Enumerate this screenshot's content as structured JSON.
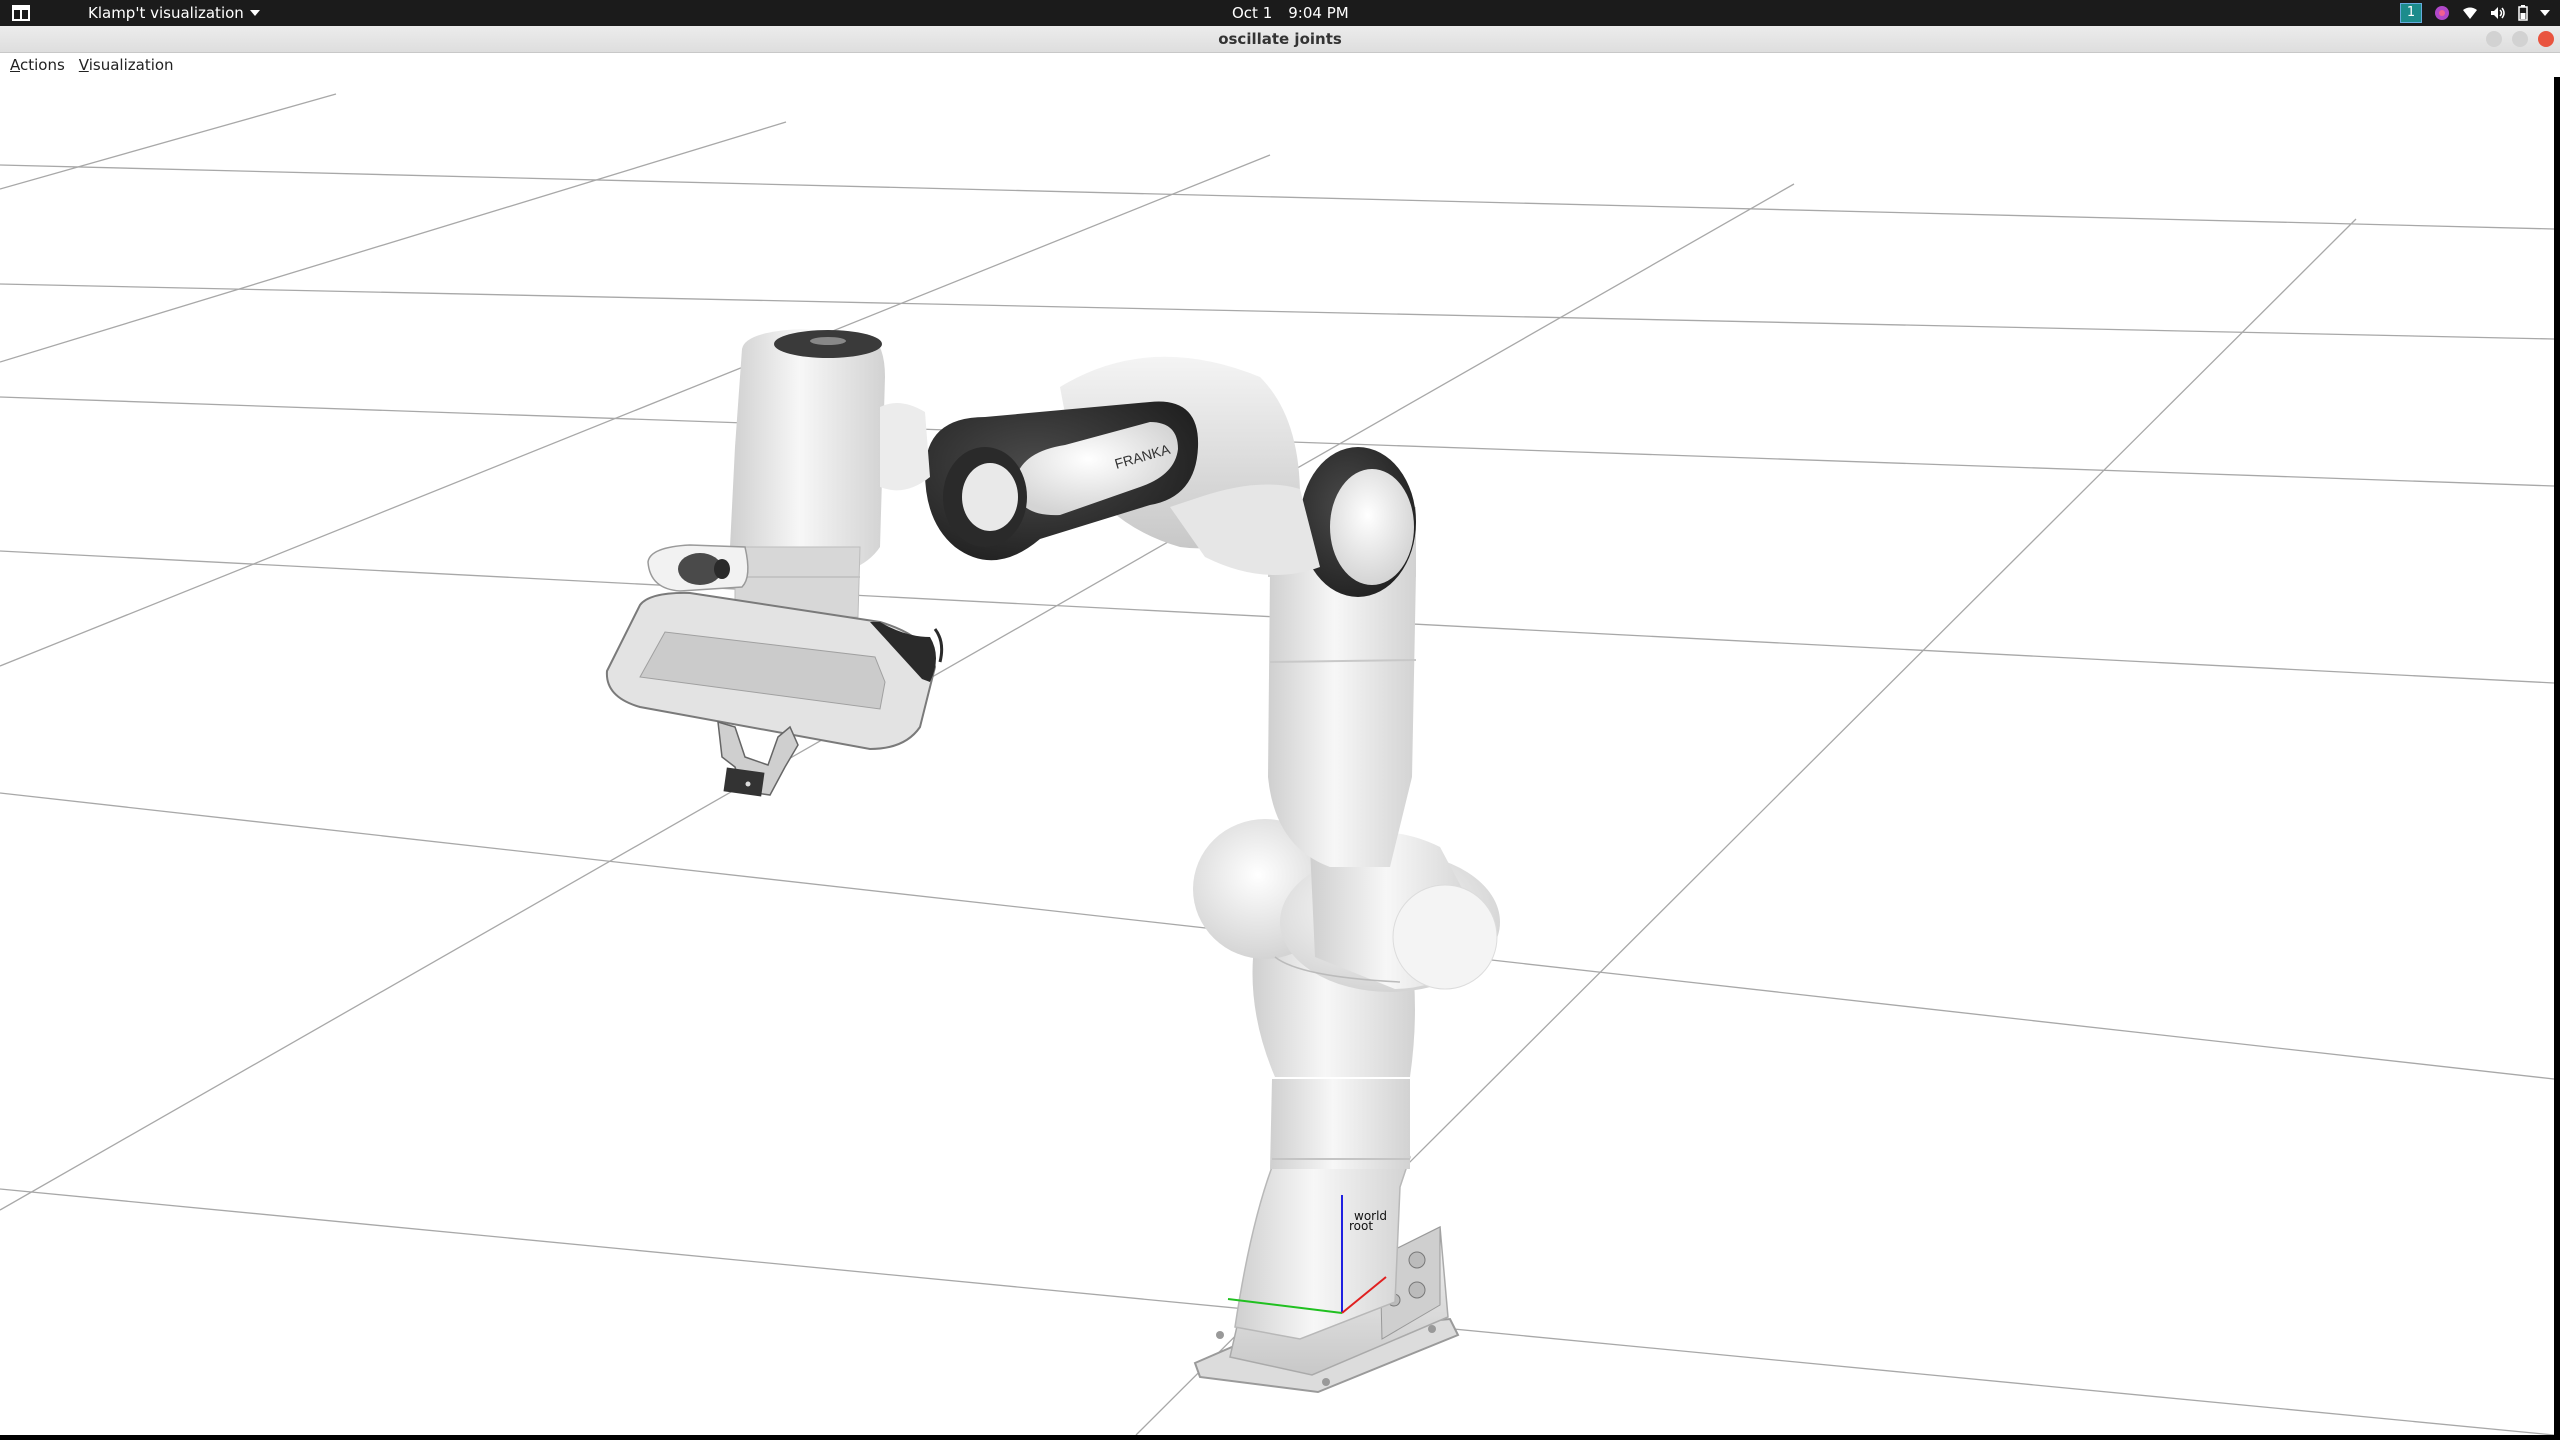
{
  "topbar": {
    "app_menu": "Klamp't visualization",
    "date": "Oct 1",
    "time": "9:04 PM",
    "workspace": "1"
  },
  "window": {
    "title": "oscillate joints"
  },
  "menubar": {
    "items": [
      {
        "label": "Actions",
        "mnemonic": "A",
        "rest": "ctions"
      },
      {
        "label": "Visualization",
        "mnemonic": "V",
        "rest": "isualization"
      }
    ]
  },
  "viewport": {
    "robot_text": "FRANKA",
    "frame_labels": [
      "world",
      "root"
    ],
    "axis_colors": {
      "x": "#e02020",
      "y": "#20c020",
      "z": "#2020e0"
    }
  },
  "icons": [
    "activities-icon",
    "dropdown-icon",
    "workspace-indicator",
    "app-indicator-icon",
    "wifi-icon",
    "volume-icon",
    "battery-icon",
    "system-menu-icon"
  ]
}
